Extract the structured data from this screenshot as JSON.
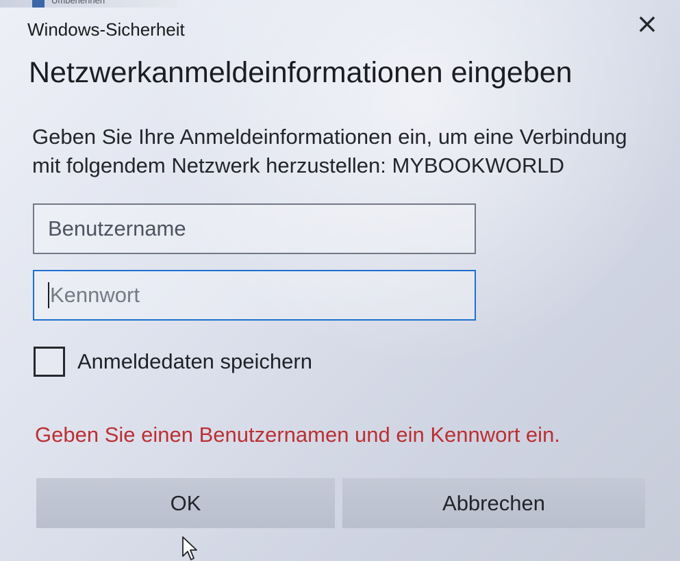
{
  "window": {
    "title": "Windows-Sicherheit",
    "close_label": "×"
  },
  "background": {
    "partial_text": "Umbenennen"
  },
  "dialog": {
    "heading": "Netzwerkanmeldeinformationen eingeben",
    "description_line_1": "Geben Sie Ihre Anmeldeinformationen ein, um eine Verbindung",
    "description_line_2": "mit folgendem Netzwerk herzustellen: MYBOOKWORLD"
  },
  "form": {
    "username": {
      "placeholder": "Benutzername",
      "value": ""
    },
    "password": {
      "placeholder": "Kennwort",
      "value": ""
    },
    "remember": {
      "label": "Anmeldedaten speichern",
      "checked": false
    },
    "error_message": "Geben Sie einen Benutzernamen und ein Kennwort ein."
  },
  "buttons": {
    "ok": "OK",
    "cancel": "Abbrechen"
  },
  "icons": {
    "close": "close-icon",
    "pointer": "mouse-pointer-icon",
    "checkbox": "checkbox-icon"
  },
  "colors": {
    "focus_border": "#1c6fcf",
    "error_text": "#bb2f32",
    "button_fill": "#c0c5d2"
  }
}
